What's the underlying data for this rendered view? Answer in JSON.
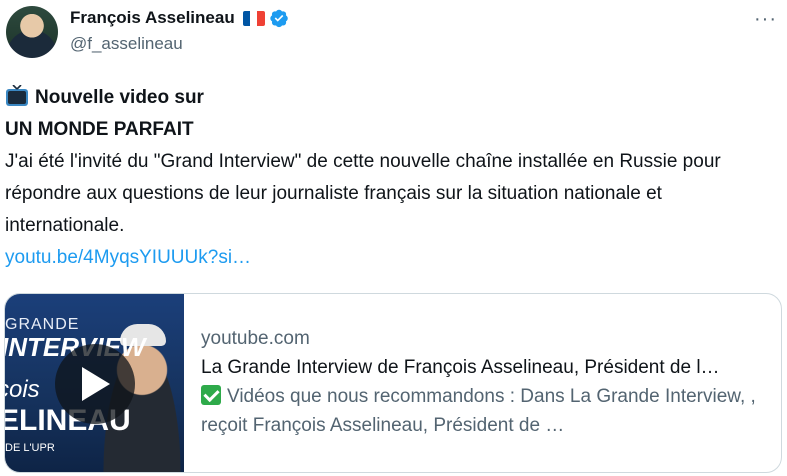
{
  "author": {
    "display_name": "François Asselineau",
    "handle": "@f_asselineau",
    "icons": [
      "france-flag-icon",
      "verified-badge-icon"
    ]
  },
  "more_label": "···",
  "post": {
    "line1": "Nouvelle video sur",
    "line2": "UN MONDE PARFAIT",
    "body": "J'ai été l'invité du \"Grand Interview\" de cette nouvelle chaîne installée en Russie pour répondre aux questions de leur journaliste français sur la situation nationale et internationale.",
    "link": "youtu.be/4MyqsYIUUUk?si…"
  },
  "card": {
    "domain": "youtube.com",
    "title": "La Grande Interview de François Asselineau, Président de l…",
    "description": "Vidéos que nous recommandons : Dans La Grande Interview, , reçoit François Asselineau, Président de …",
    "thumbnail_text": {
      "t1": "GRANDE",
      "t2": "INTERVIEW",
      "t3": "çois",
      "t4": "ELINEAU",
      "t5": "DE L'UPR"
    }
  },
  "colors": {
    "link": "#1d9bf0",
    "secondary_text": "#536471",
    "verified": "#1d9bf0"
  }
}
